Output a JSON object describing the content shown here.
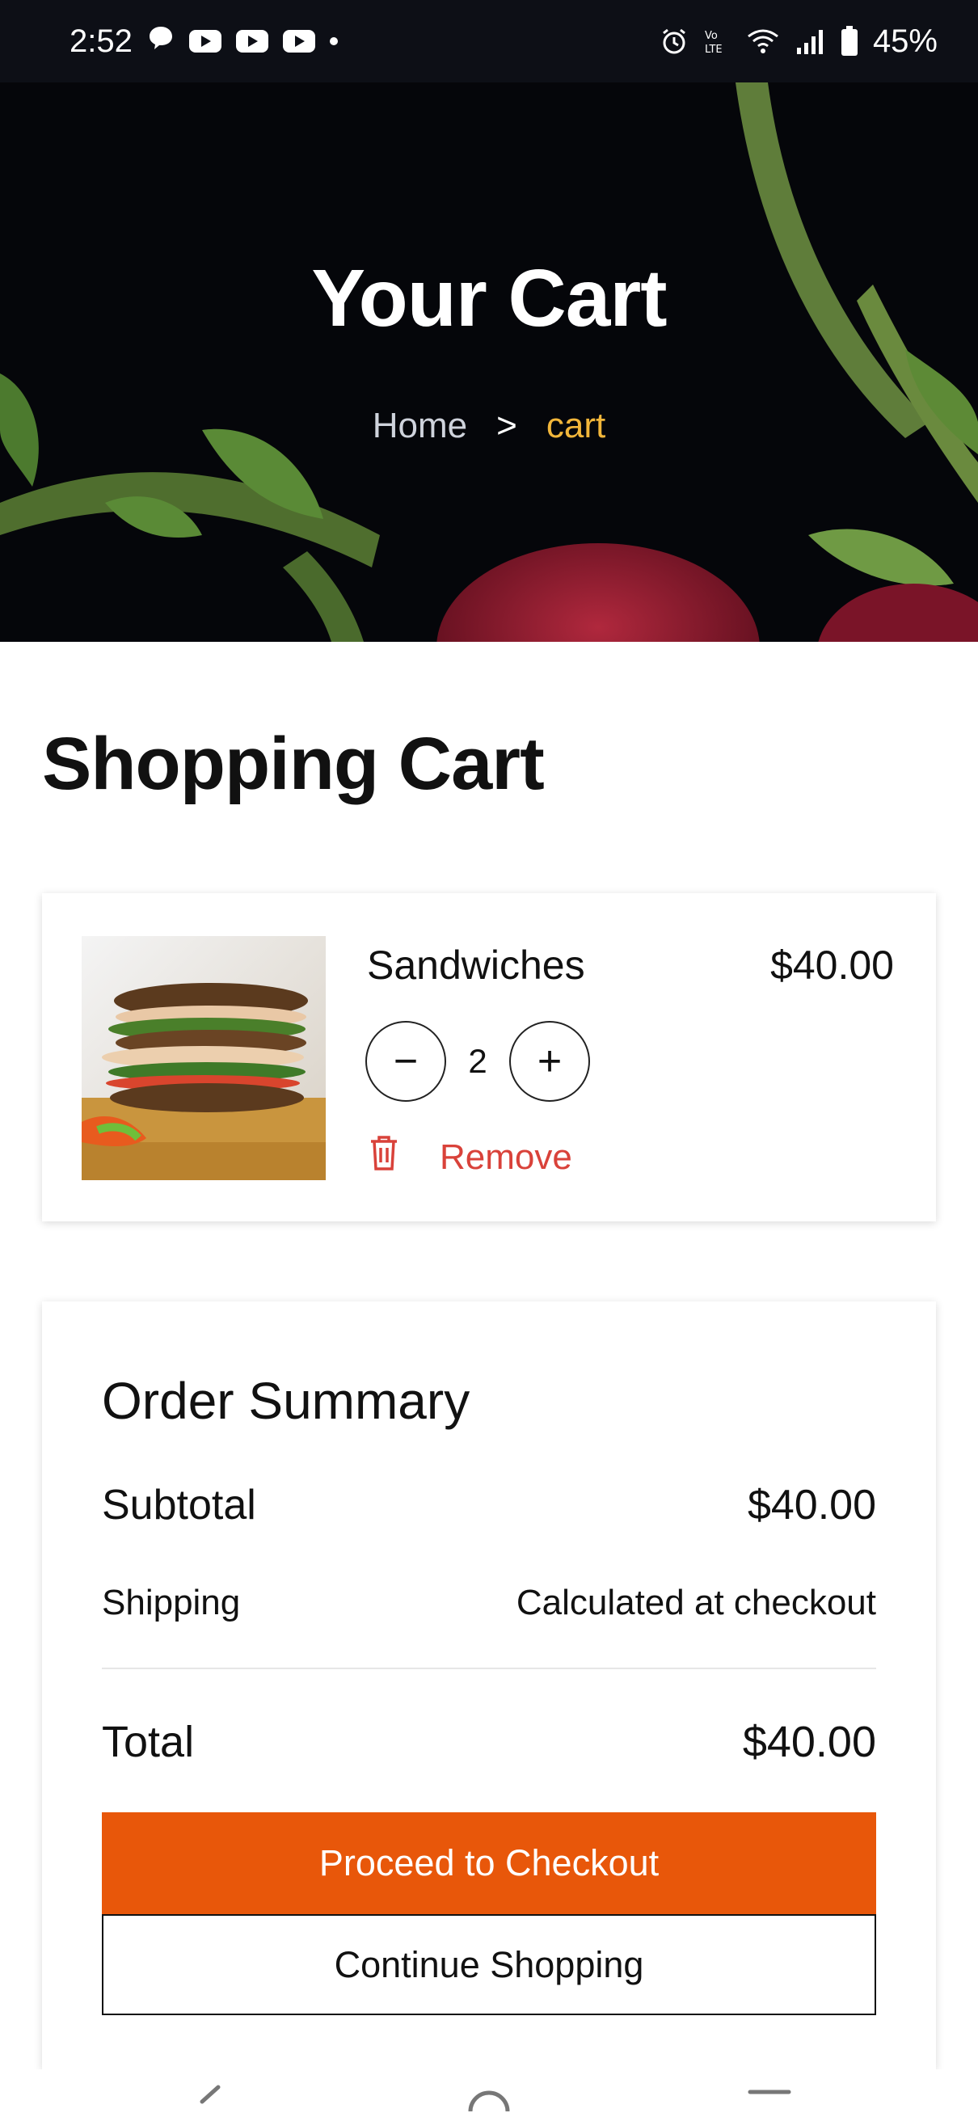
{
  "status_bar": {
    "time": "2:52",
    "battery": "45%",
    "icons": [
      "chat-icon",
      "youtube-icon",
      "youtube-icon",
      "youtube-icon",
      "dot-icon",
      "alarm-icon",
      "volte-icon",
      "wifi-icon",
      "signal-icon",
      "battery-icon"
    ]
  },
  "hero": {
    "title": "Your Cart",
    "breadcrumb": {
      "home": "Home",
      "separator": ">",
      "current": "cart"
    }
  },
  "page": {
    "title": "Shopping Cart"
  },
  "cart": {
    "items": [
      {
        "name": "Sandwiches",
        "price": "$40.00",
        "quantity": "2",
        "decrement_label": "−",
        "increment_label": "+",
        "remove_label": "Remove",
        "image": "sandwich-image"
      }
    ]
  },
  "summary": {
    "title": "Order Summary",
    "subtotal_label": "Subtotal",
    "subtotal_value": "$40.00",
    "shipping_label": "Shipping",
    "shipping_value": "Calculated at checkout",
    "total_label": "Total",
    "total_value": "$40.00",
    "checkout_label": "Proceed to Checkout",
    "continue_label": "Continue Shopping"
  },
  "colors": {
    "accent": "#e8570a",
    "remove": "#d9423a",
    "breadcrumb_current": "#f2b63a",
    "status_bar_bg": "#0d0f16"
  }
}
